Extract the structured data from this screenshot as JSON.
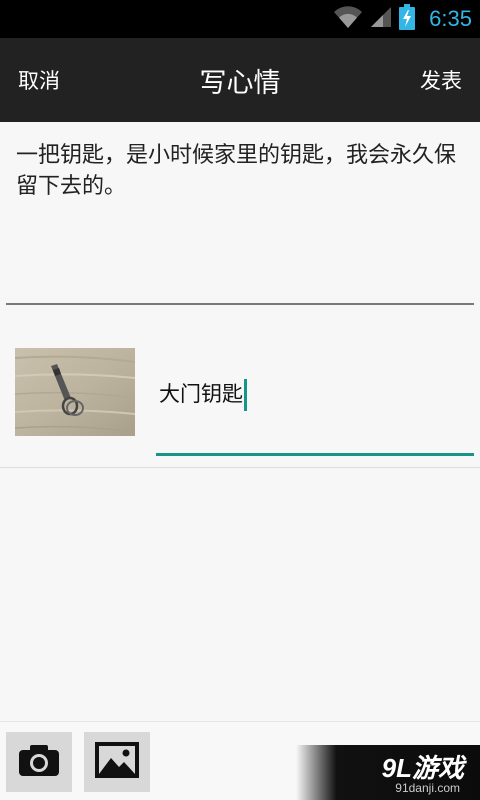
{
  "status_bar": {
    "time": "6:35",
    "icons": [
      "wifi-icon",
      "signal-icon",
      "battery-charging-icon"
    ]
  },
  "action_bar": {
    "cancel_label": "取消",
    "title": "写心情",
    "publish_label": "发表"
  },
  "mood": {
    "text": "一把钥匙，是小时候家里的钥匙，我会永久保留下去的。"
  },
  "attachment": {
    "caption_value": "大门钥匙",
    "image": "key-photo"
  },
  "toolbar": {
    "buttons": [
      "camera-icon",
      "gallery-icon"
    ]
  },
  "watermark": {
    "logo_text": "9L游戏",
    "url": "91danji.com"
  },
  "colors": {
    "accent": "#17958a",
    "time": "#33b5e5",
    "action_bar_bg": "#222222",
    "status_bar_bg": "#000000"
  }
}
